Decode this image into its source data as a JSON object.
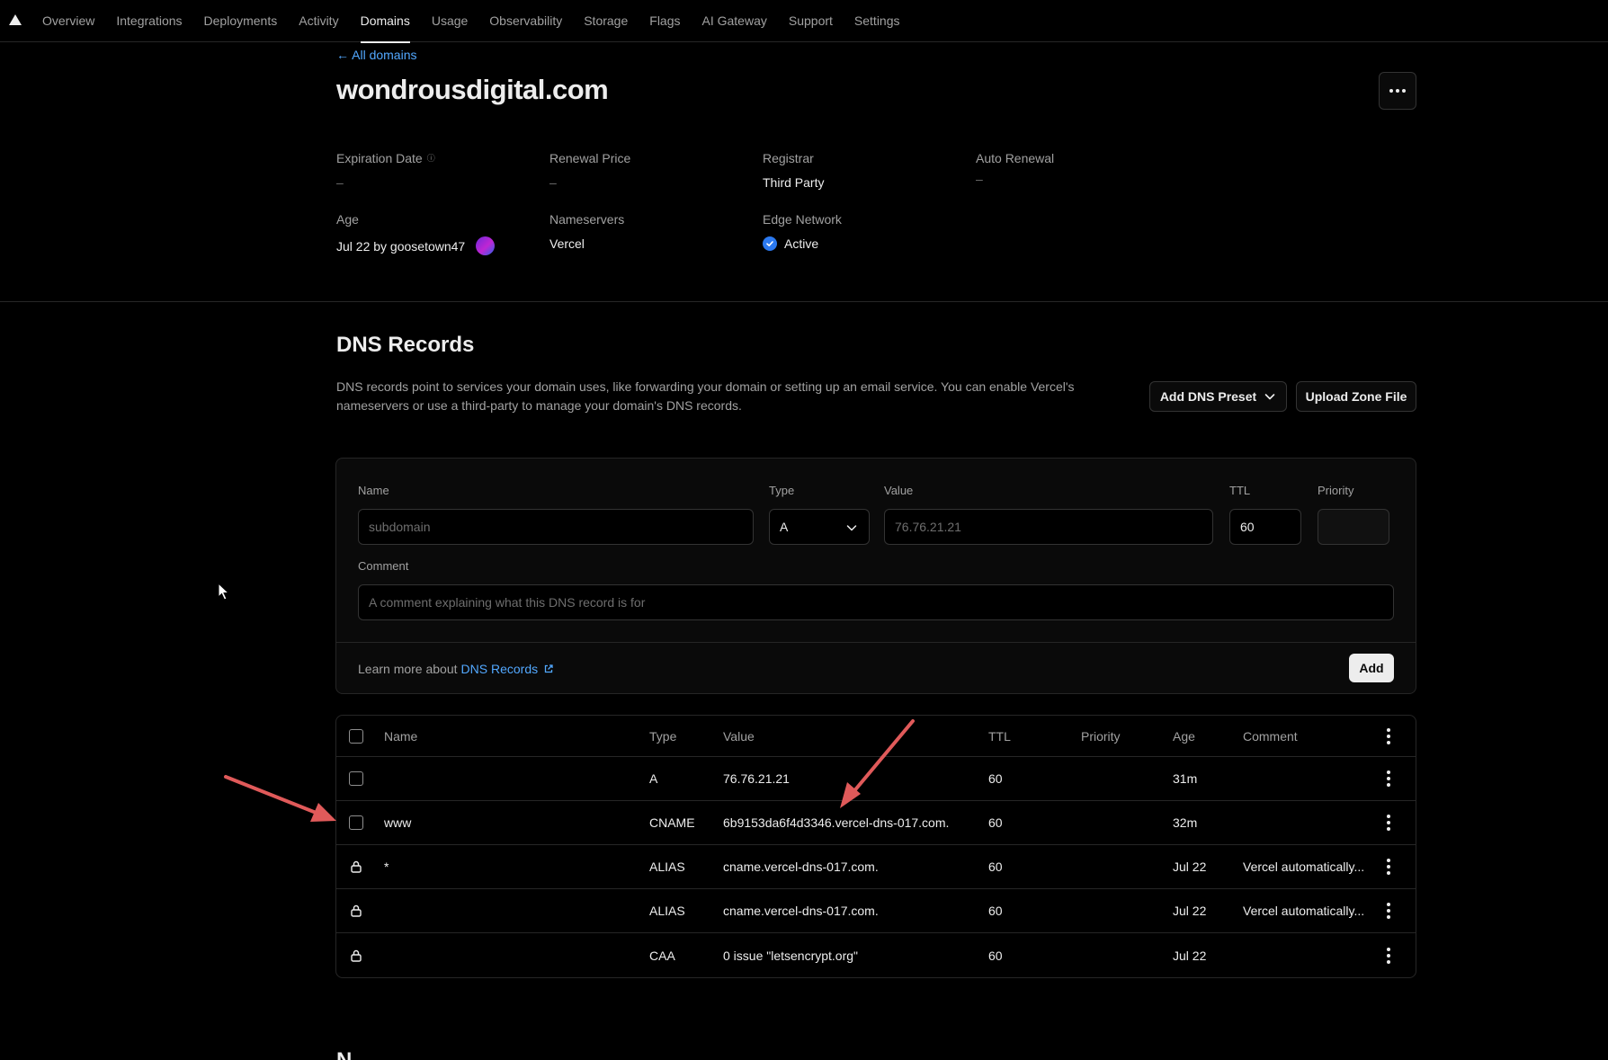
{
  "nav": {
    "tabs": [
      "Overview",
      "Integrations",
      "Deployments",
      "Activity",
      "Domains",
      "Usage",
      "Observability",
      "Storage",
      "Flags",
      "AI Gateway",
      "Support",
      "Settings"
    ],
    "active": "Domains"
  },
  "header": {
    "back_link": "← All domains",
    "domain": "wondrousdigital.com"
  },
  "details": {
    "expiration_label": "Expiration Date",
    "expiration_value": "–",
    "renewal_label": "Renewal Price",
    "renewal_value": "–",
    "registrar_label": "Registrar",
    "registrar_value": "Third Party",
    "auto_renewal_label": "Auto Renewal",
    "auto_renewal_value": "–",
    "age_label": "Age",
    "age_value": "Jul 22 by goosetown47",
    "nameservers_label": "Nameservers",
    "nameservers_value": "Vercel",
    "edge_label": "Edge Network",
    "edge_value": "Active"
  },
  "dns": {
    "title": "DNS Records",
    "description": "DNS records point to services your domain uses, like forwarding your domain or setting up an email service. You can enable Vercel's nameservers or use a third-party to manage your domain's DNS records.",
    "preset_button": "Add DNS Preset",
    "upload_button": "Upload Zone File"
  },
  "form": {
    "name_label": "Name",
    "name_placeholder": "subdomain",
    "type_label": "Type",
    "type_value": "A",
    "value_label": "Value",
    "value_placeholder": "76.76.21.21",
    "ttl_label": "TTL",
    "ttl_value": "60",
    "priority_label": "Priority",
    "comment_label": "Comment",
    "comment_placeholder": "A comment explaining what this DNS record is for",
    "learn_more": "Learn more about",
    "learn_link": "DNS Records",
    "add_button": "Add"
  },
  "table": {
    "headers": {
      "name": "Name",
      "type": "Type",
      "value": "Value",
      "ttl": "TTL",
      "priority": "Priority",
      "age": "Age",
      "comment": "Comment"
    },
    "rows": [
      {
        "locked": false,
        "name": "",
        "type": "A",
        "value": "76.76.21.21",
        "ttl": "60",
        "priority": "",
        "age": "31m",
        "comment": ""
      },
      {
        "locked": false,
        "name": "www",
        "type": "CNAME",
        "value": "6b9153da6f4d3346.vercel-dns-017.com.",
        "ttl": "60",
        "priority": "",
        "age": "32m",
        "comment": ""
      },
      {
        "locked": true,
        "name": "*",
        "type": "ALIAS",
        "value": "cname.vercel-dns-017.com.",
        "ttl": "60",
        "priority": "",
        "age": "Jul 22",
        "comment": "Vercel automatically..."
      },
      {
        "locked": true,
        "name": "",
        "type": "ALIAS",
        "value": "cname.vercel-dns-017.com.",
        "ttl": "60",
        "priority": "",
        "age": "Jul 22",
        "comment": "Vercel automatically..."
      },
      {
        "locked": true,
        "name": "",
        "type": "CAA",
        "value": "0 issue \"letsencrypt.org\"",
        "ttl": "60",
        "priority": "",
        "age": "Jul 22",
        "comment": ""
      }
    ]
  },
  "next_section": "N",
  "colors": {
    "link": "#52a8ff",
    "active_check": "#2b79f0",
    "annotation_arrow": "#e05a5a",
    "background": "#000000"
  },
  "icons": [
    "vercel-logo-icon",
    "more-horizontal-icon",
    "info-icon",
    "check-circle-icon",
    "chevron-down-icon",
    "external-link-icon",
    "lock-icon",
    "more-vertical-icon",
    "cursor-icon"
  ]
}
